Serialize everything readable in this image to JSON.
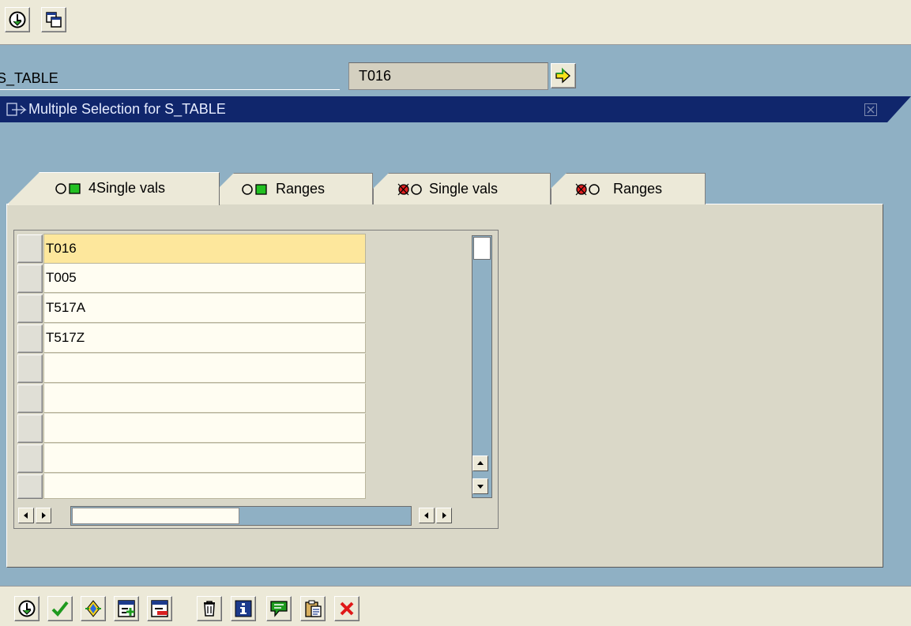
{
  "top_toolbar": {
    "buttons": [
      {
        "name": "execute-icon"
      },
      {
        "name": "copy-screen-icon"
      }
    ]
  },
  "field": {
    "label": "S_TABLE",
    "value": "T016"
  },
  "dialog": {
    "title": "Multiple Selection for S_TABLE",
    "tabs": [
      {
        "label": "4Single vals",
        "status": "include",
        "active": true
      },
      {
        "label": "Ranges",
        "status": "include",
        "active": false
      },
      {
        "label": "Single vals",
        "status": "exclude",
        "active": false
      },
      {
        "label": "Ranges",
        "status": "exclude",
        "active": false
      }
    ],
    "table": {
      "rows": [
        "T016",
        "T005",
        "T517A",
        "T517Z",
        "",
        "",
        "",
        "",
        ""
      ]
    }
  },
  "bottom_toolbar": {
    "buttons": [
      {
        "name": "execute-icon"
      },
      {
        "name": "checkmark-icon"
      },
      {
        "name": "multiple-selection-icon"
      },
      {
        "name": "insert-line-icon"
      },
      {
        "name": "delete-line-icon"
      },
      {
        "name": "trash-icon"
      },
      {
        "name": "info-icon"
      },
      {
        "name": "import-text-icon"
      },
      {
        "name": "paste-clipboard-icon"
      },
      {
        "name": "cancel-icon"
      }
    ]
  },
  "colors": {
    "desktop": "#8fb0c4",
    "panel": "#ece9d8",
    "title_bar": "#10266c",
    "selected_row": "#fde79c",
    "cell": "#fffdf2",
    "scroll_track": "#8fb0c4"
  }
}
